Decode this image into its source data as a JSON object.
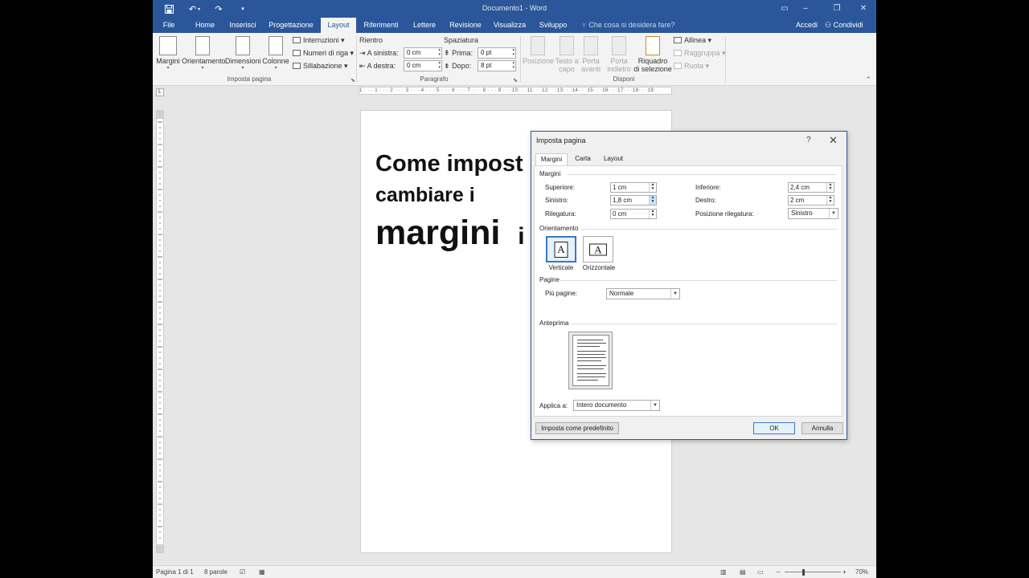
{
  "titlebar": {
    "document_title": "Documento1 - Word",
    "icons": [
      "save-icon",
      "undo-icon",
      "redo-icon",
      "customize-qat-icon",
      "ribbon-display-icon",
      "minimize-icon",
      "restore-icon",
      "close-icon"
    ]
  },
  "tabs": {
    "file": "File",
    "home": "Home",
    "insert": "Inserisci",
    "design": "Progettazione",
    "layout": "Layout",
    "references": "Riferimenti",
    "mailings": "Lettere",
    "review": "Revisione",
    "view": "Visualizza",
    "developer": "Sviluppo",
    "tell_me": "Che cosa si desidera fare?",
    "sign_in": "Accedi",
    "share": "Condividi"
  },
  "ribbon": {
    "page_setup": {
      "margins": "Margini",
      "orientation": "Orientamento",
      "size": "Dimensioni",
      "columns": "Colonne",
      "breaks": "Interruzioni",
      "line_numbers": "Numeri di riga",
      "hyphenation": "Sillabazione",
      "label": "Imposta pagina"
    },
    "paragraph": {
      "indent_heading": "Rientro",
      "spacing_heading": "Spaziatura",
      "left_label": "A sinistra:",
      "left_value": "0 cm",
      "right_label": "A destra:",
      "right_value": "0 cm",
      "before_label": "Prima:",
      "before_value": "0 pt",
      "after_label": "Dopo:",
      "after_value": "8 pt",
      "label": "Paragrafo"
    },
    "arrange": {
      "position": "Posizione",
      "wrap_text_1": "Testo a",
      "wrap_text_2": "capo",
      "bring_forward_1": "Porta",
      "bring_forward_2": "avanti",
      "send_backward_1": "Porta",
      "send_backward_2": "indietro",
      "selection_pane_1": "Riquadro",
      "selection_pane_2": "di selezione",
      "align": "Allinea",
      "group": "Raggruppa",
      "rotate": "Ruota",
      "label": "Disponi"
    }
  },
  "document": {
    "line1": "Come impost",
    "line2": "cambiare i",
    "line3": "margini",
    "line3_tail": "i"
  },
  "ruler": {
    "horizontal": "1 · · · 1 · · · 2 · · · 3 · · · 4 · · · 5 · · · 6 · · · 7 · · · 8 · · · 9 · · ·10· · ·11· · ·12· · ·13· · ·14· · ·15· · ·16· · ·17· · ·18· · ·19·"
  },
  "statusbar": {
    "page": "Pagina 1 di 1",
    "words": "8 parole",
    "zoom": "70%"
  },
  "dialog": {
    "title": "Imposta pagina",
    "help": "?",
    "close": "✕",
    "tabs": [
      "Margini",
      "Carta",
      "Layout"
    ],
    "margins_section": "Margini",
    "top_label": "Superiore:",
    "top_value": "1 cm",
    "bottom_label": "Inferiore:",
    "bottom_value": "2,4 cm",
    "left_label": "Sinistro:",
    "left_value": "1,8 cm",
    "right_label": "Destro:",
    "right_value": "2 cm",
    "gutter_label": "Rilegatura:",
    "gutter_value": "0 cm",
    "gutter_pos_label": "Posizione rilegatura:",
    "gutter_pos_value": "Sinistro",
    "orientation_section": "Orientamento",
    "portrait": "Verticale",
    "landscape": "Orizzontale",
    "pages_section": "Pagine",
    "multiple_pages_label": "Più pagine:",
    "multiple_pages_value": "Normale",
    "preview_section": "Anteprima",
    "apply_to_label": "Applica a:",
    "apply_to_value": "Intero documento",
    "set_default": "Imposta come predefinito",
    "ok": "OK",
    "cancel": "Annulla"
  },
  "colors": {
    "brand": "#2b579a",
    "ribbon": "#f3f3f3",
    "workspace": "#e6e6e6",
    "accent_border": "#3b78c2"
  }
}
